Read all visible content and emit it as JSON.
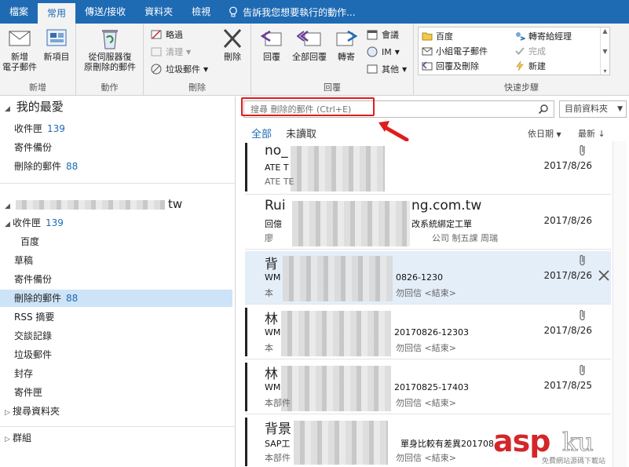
{
  "tabs": [
    "檔案",
    "常用",
    "傳送/接收",
    "資料夾",
    "檢視"
  ],
  "active_tab": "常用",
  "tell_me": "告訴我您想要執行的動作...",
  "ribbon": {
    "new_group": {
      "label": "新增",
      "new_email": "新增\n電子郵件",
      "new_items": "新項目"
    },
    "actions_group": {
      "label": "動作",
      "restore": "從伺服器復\n原刪除的郵件"
    },
    "delete_group": {
      "label": "刪除",
      "ignore": "略過",
      "cleanup": "清理",
      "junk": "垃圾郵件",
      "delete": "刪除"
    },
    "respond_group": {
      "label": "回覆",
      "reply": "回覆",
      "reply_all": "全部回覆",
      "forward": "轉寄",
      "meeting": "會議",
      "im": "IM",
      "more": "其他"
    },
    "quick_steps_group": {
      "label": "快速步驟",
      "items": [
        "百度",
        "轉寄給經理",
        "小組電子郵件",
        "完成",
        "回覆及刪除",
        "新建"
      ]
    }
  },
  "folders": {
    "favorites_header": "我的最愛",
    "favorites": [
      {
        "name": "收件匣",
        "count": "139"
      },
      {
        "name": "寄件備份",
        "count": ""
      },
      {
        "name": "刪除的郵件",
        "count": "88"
      }
    ],
    "account_suffix": "tw",
    "account_items": [
      {
        "name": "收件匣",
        "count": "139"
      },
      {
        "name": "百度",
        "count": ""
      },
      {
        "name": "草稿",
        "count": ""
      },
      {
        "name": "寄件備份",
        "count": ""
      },
      {
        "name": "刪除的郵件",
        "count": "88"
      },
      {
        "name": "RSS 摘要",
        "count": ""
      },
      {
        "name": "交談記錄",
        "count": ""
      },
      {
        "name": "垃圾郵件",
        "count": ""
      },
      {
        "name": "封存",
        "count": ""
      },
      {
        "name": "寄件匣",
        "count": ""
      }
    ],
    "search_folders": "搜尋資料夾",
    "groups": "群組"
  },
  "search": {
    "placeholder": "搜尋 刪除的郵件 (Ctrl+E)",
    "scope": "目前資料夾"
  },
  "filters": {
    "all": "全部",
    "unread": "未讀取",
    "sort": "依日期",
    "order": "最新"
  },
  "messages": [
    {
      "sender": "no_",
      "subject": "ATE T",
      "preview": "ATE TE",
      "date": "2017/8/26"
    },
    {
      "sender": "Rui",
      "sender_tail": "ng.com.tw",
      "subject": "回億",
      "subject_tail": "改系統綁定工單",
      "preview": "廖",
      "preview_tail": "公司 制五課 周瑞",
      "date": "2017/8/26"
    },
    {
      "sender": "背",
      "subject": "WM",
      "subject_tail": "0826-1230",
      "preview": "本",
      "preview_tail": "勿回信 <結束>",
      "date": "2017/8/26"
    },
    {
      "sender": "林",
      "subject": "WM",
      "subject_tail": "20170826-12303",
      "preview": "本",
      "preview_tail": "勿回信 <結束>",
      "date": "2017/8/26"
    },
    {
      "sender": "林",
      "subject": "WM",
      "subject_tail": "20170825-17403",
      "preview": "本部件",
      "preview_tail": "勿回信 <結束>",
      "date": "2017/8/25"
    },
    {
      "sender": "背景",
      "subject": "SAP工",
      "subject_tail": "單身比較有差異201708",
      "preview": "本部件",
      "preview_tail": "勿回信 <結束>",
      "date": ""
    }
  ],
  "watermark": {
    "brand": "asp",
    "brand_tail": "ku",
    "sub": "免費網站源碼下載站"
  },
  "colors": {
    "accent": "#1e6ab3",
    "highlight": "#e01c1c"
  }
}
